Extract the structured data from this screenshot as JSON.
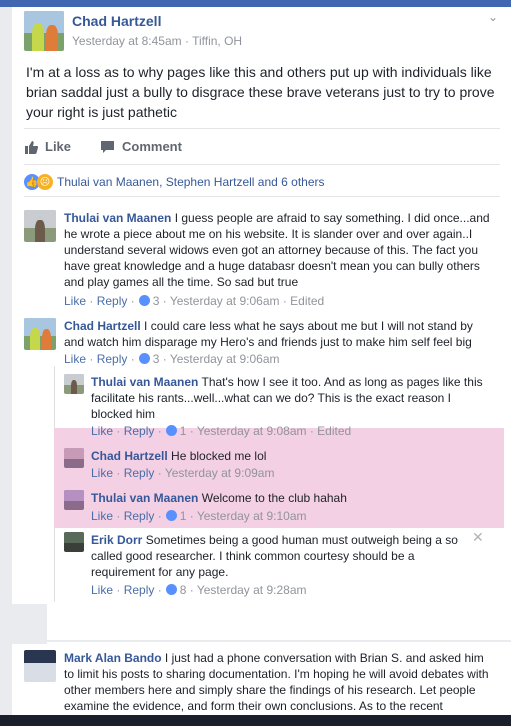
{
  "post": {
    "author": "Chad Hartzell",
    "meta": "Yesterday at 8:45am · Tiffin, OH",
    "text": "I'm at a loss as to why pages like this and others put up with individuals like brian saddal just a bully to disgrace these brave veterans just to try to prove your right is just pathetic",
    "like_label": "Like",
    "comment_label": "Comment",
    "reactions_text": "Thulai van Maanen, Stephen Hartzell and 6 others"
  },
  "comments": [
    {
      "author": "Thulai van Maanen",
      "text": "I guess people are afraid to say something. I did once...and he wrote a piece about me on his website. It is slander over and over again..I understand several widows even got an attorney because of this. The fact you have great knowledge and a huge databasr doesn't mean you can bully others and play games all the time. So sad but true",
      "like": "Like",
      "reply": "Reply",
      "count": "3",
      "time": "Yesterday at 9:06am",
      "edited": "Edited"
    },
    {
      "author": "Chad Hartzell",
      "text": "I could care less what he says about me but I will not stand by and watch him disparage my Hero's and friends just to make him self feel big",
      "like": "Like",
      "reply": "Reply",
      "count": "3",
      "time": "Yesterday at 9:06am"
    }
  ],
  "replies": [
    {
      "author": "Thulai van Maanen",
      "text": "That's how I see it too. And as long as pages like this facilitate his rants...well...what can we do? This is the exact reason I blocked him",
      "like": "Like",
      "reply": "Reply",
      "count": "1",
      "time": "Yesterday at 9:08am",
      "edited": "Edited"
    },
    {
      "author": "Chad Hartzell",
      "text": "He blocked me lol",
      "like": "Like",
      "reply": "Reply",
      "time": "Yesterday at 9:09am"
    },
    {
      "author": "Thulai van Maanen",
      "text": "Welcome to the club hahah",
      "like": "Like",
      "reply": "Reply",
      "count": "1",
      "time": "Yesterday at 9:10am"
    },
    {
      "author": "Erik Dorr",
      "text": "Sometimes being a good human must outweigh being a so called good researcher. I think common courtesy should be a requirement for any page.",
      "like": "Like",
      "reply": "Reply",
      "count": "8",
      "time": "Yesterday at 9:28am"
    }
  ],
  "last_comment": {
    "author": "Mark Alan Bando",
    "text": "I just had a phone conversation with Brian S. and asked him to limit his posts to sharing documentation. I'm hoping he will avoid debates with other members here and simply share the findings of his research. Let people examine the evidence, and form their own conclusions. As to the recent"
  },
  "colors": {
    "link": "#365899",
    "meta": "#90949c",
    "highlight": "#f4d0e4",
    "like_badge": "#5890ff"
  }
}
